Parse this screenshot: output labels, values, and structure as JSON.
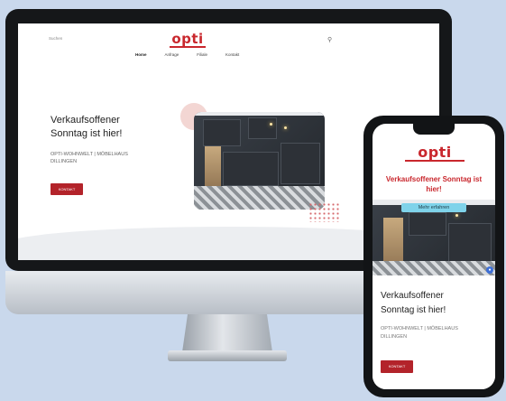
{
  "desktop": {
    "search_text": "Suchen",
    "logo": "opti",
    "cart_icon": "cart-icon",
    "nav": [
      "Home",
      "Anfrage",
      "Filiale",
      "Kontakt"
    ],
    "headline_lines": [
      "Verkaufsoffener",
      "Sonntag ist hier!"
    ],
    "subline_lines": [
      "OPTI-WOHNWELT | MÖBELHAUS",
      "DILLINGEN"
    ],
    "button_label": "KONTAKT"
  },
  "mobile": {
    "logo": "opti",
    "headline": "Verkaufsoffener Sonntag ist hier!",
    "pill_label": "Mehr erfahren",
    "chat_icon": "chat-icon",
    "title_lines": [
      "Verkaufsoffener",
      "Sonntag ist hier!"
    ],
    "subline_lines": [
      "OPTI-WOHNWELT | MÖBELHAUS",
      "DILLINGEN"
    ],
    "button_label": "KONTAKT"
  },
  "colors": {
    "brand_red": "#c9272d",
    "button_red": "#b3232a",
    "background": "#c9d8ec"
  }
}
